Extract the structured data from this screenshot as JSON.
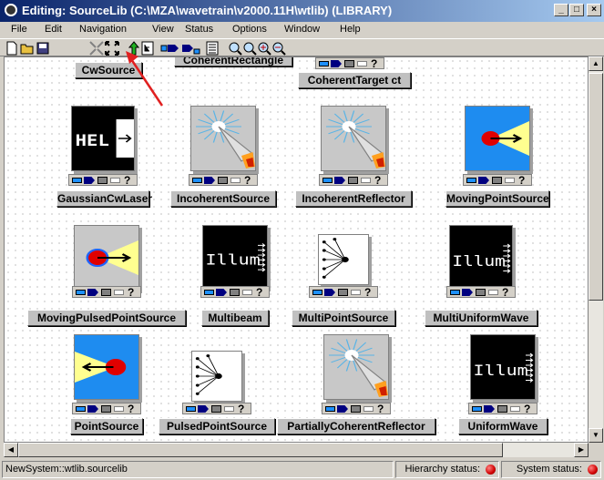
{
  "window": {
    "title": "Editing:  SourceLib  (C:\\MZA\\wavetrain\\v2000.11H\\wtlib) (LIBRARY)",
    "buttons": {
      "minimize": "_",
      "maximize": "□",
      "close": "×"
    }
  },
  "menu": [
    {
      "label": "File"
    },
    {
      "label": "Edit"
    },
    {
      "label": "Navigation"
    },
    {
      "label": "View"
    },
    {
      "label": "Status"
    },
    {
      "label": "Options"
    },
    {
      "label": "Window"
    },
    {
      "label": "Help"
    }
  ],
  "toolbar": {
    "icons": [
      "new-doc-icon",
      "open-folder-icon",
      "save-icon",
      "shrink-icon",
      "expand-icon",
      "up-hierarchy-icon",
      "hierarchy-tree-icon",
      "port-arrow-icon",
      "port-arrow-2-icon",
      "list-icon",
      "zoom-fit-icon",
      "zoom-fit-2-icon",
      "zoom-in-icon",
      "zoom-out-icon"
    ]
  },
  "blocks": {
    "top": [
      {
        "label": "CwSource"
      },
      {
        "label": "CoherentRectangle"
      },
      {
        "label": "CoherentTarget ct"
      }
    ],
    "rows": [
      [
        {
          "label": "GaussianCwLaser",
          "icon": "hel-laser"
        },
        {
          "label": "IncoherentSource",
          "icon": "sunburst"
        },
        {
          "label": "IncoherentReflector",
          "icon": "sunburst"
        },
        {
          "label": "MovingPointSource",
          "icon": "moving-point"
        }
      ],
      [
        {
          "label": "MovingPulsedPointSource",
          "icon": "moving-pulsed"
        },
        {
          "label": "Multibeam",
          "icon": "illum"
        },
        {
          "label": "MultiPointSource",
          "icon": "multipoint"
        },
        {
          "label": "MultiUniformWave",
          "icon": "illum"
        }
      ],
      [
        {
          "label": "PointSource",
          "icon": "point-source"
        },
        {
          "label": "PulsedPointSource",
          "icon": "multipoint"
        },
        {
          "label": "PartiallyCoherentReflector",
          "icon": "sunburst"
        },
        {
          "label": "UniformWave",
          "icon": "illum"
        }
      ]
    ],
    "icon_text": {
      "hel": "HEL",
      "illum": "Illum"
    },
    "port_help": "?"
  },
  "status": {
    "path": "NewSystem::wtlib.sourcelib",
    "hierarchy_label": "Hierarchy status:",
    "system_label": "System status:"
  },
  "colors": {
    "title_start": "#0a246a",
    "title_end": "#a6caf0",
    "status_led": "#d00000",
    "annotation_arrow": "#e02020"
  }
}
